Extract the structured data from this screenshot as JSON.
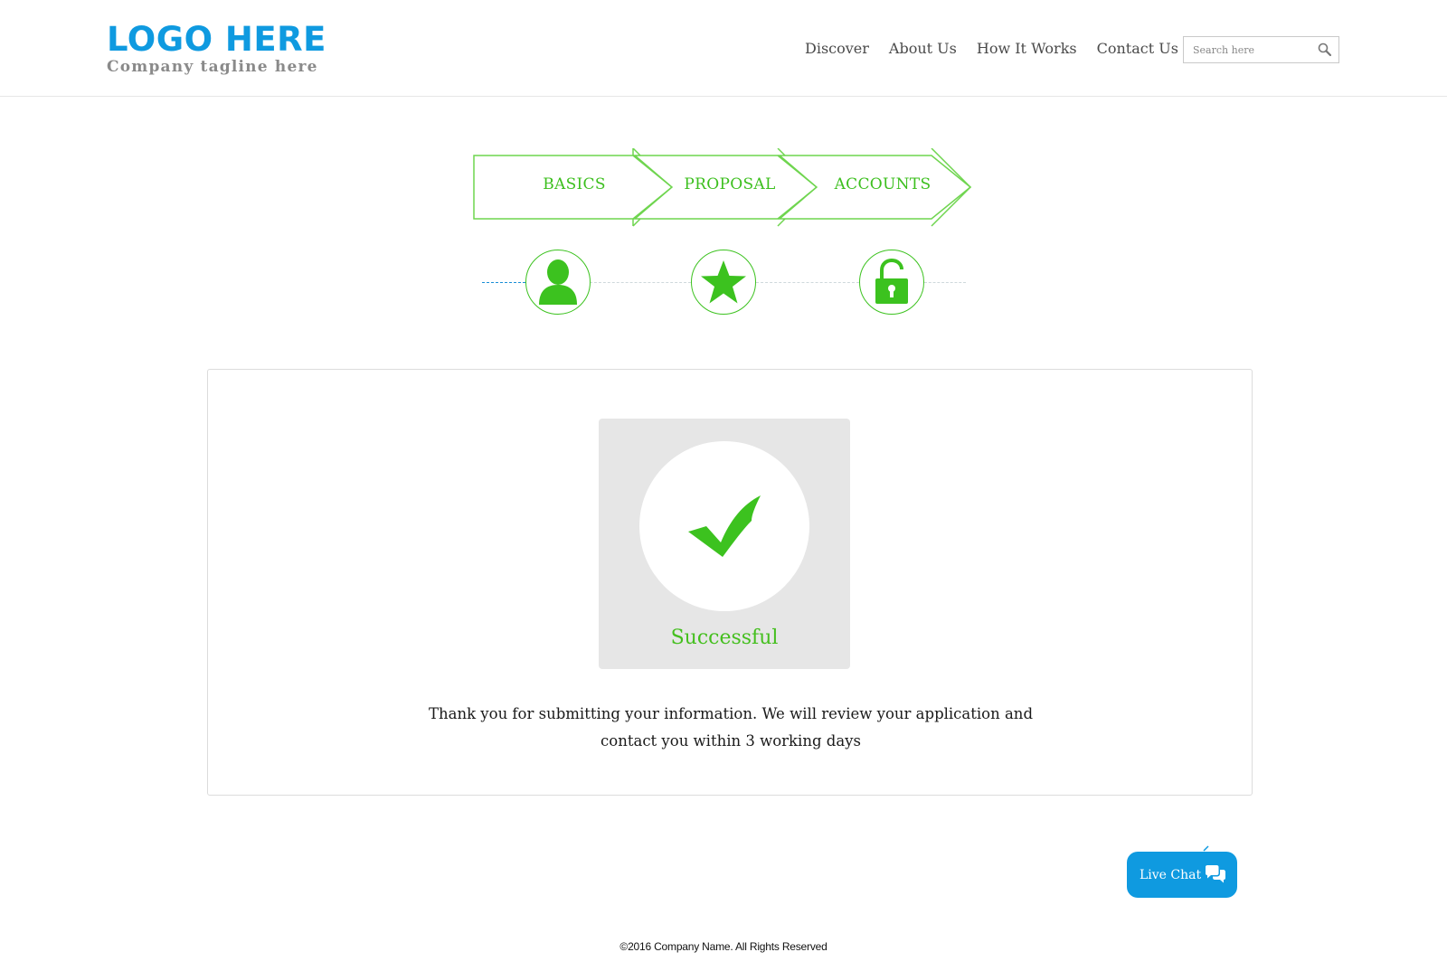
{
  "header": {
    "logo_text": "LOGO HERE",
    "tagline": "Company tagline here",
    "nav": [
      {
        "label": "Discover"
      },
      {
        "label": "About Us"
      },
      {
        "label": "How It Works"
      },
      {
        "label": "Contact Us"
      }
    ],
    "search": {
      "placeholder": "Search here",
      "value": ""
    }
  },
  "steps": [
    {
      "label": "BASICS",
      "icon": "user-icon"
    },
    {
      "label": "PROPOSAL",
      "icon": "star-icon"
    },
    {
      "label": "ACCOUNTS",
      "icon": "unlock-icon"
    }
  ],
  "result": {
    "status": "Successful",
    "message_line1": "Thank you for submitting your information. We will review your application and",
    "message_line2": "contact you within 3 working days"
  },
  "live_chat": {
    "label": "Live Chat"
  },
  "footer": {
    "copyright": "©2016 Company Name. All Rights Reserved"
  },
  "colors": {
    "brand_blue": "#0f9ae0",
    "accent_green": "#3cc21f",
    "panel_gray": "#e6e6e6"
  }
}
